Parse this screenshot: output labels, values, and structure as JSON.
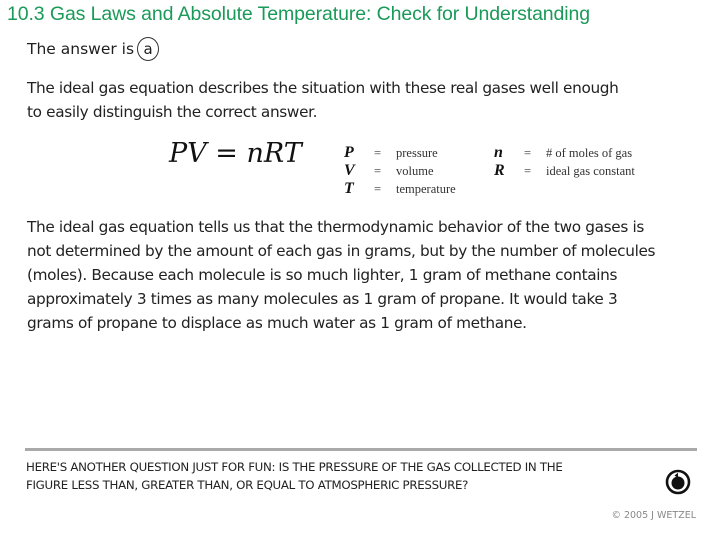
{
  "header": {
    "title": "10.3 Gas Laws and Absolute Temperature: Check for Understanding"
  },
  "answer": {
    "prefix": "The answer is",
    "choice": "a"
  },
  "explanation": {
    "paragraph1_lines": [
      "The ideal gas equation describes the situation with these real gases well enough",
      "to easily distinguish the correct answer."
    ],
    "equation": "PV = nRT",
    "variables_left": [
      {
        "symbol": "P",
        "equals": "=",
        "meaning": "pressure"
      },
      {
        "symbol": "V",
        "equals": "=",
        "meaning": "volume"
      },
      {
        "symbol": "T",
        "equals": "=",
        "meaning": "temperature"
      }
    ],
    "variables_right": [
      {
        "symbol": "n",
        "equals": "=",
        "meaning": "# of moles of gas"
      },
      {
        "symbol": "R",
        "equals": "=",
        "meaning": "ideal gas constant"
      }
    ],
    "paragraph2_lines": [
      "The ideal gas equation tells us that the thermodynamic behavior of the two gases is",
      "not determined by the amount of each gas in grams, but by the number of molecules",
      "(moles).  Because each molecule is so much lighter, 1 gram of methane contains",
      "approximately 3 times as many molecules as 1 gram of propane.  It would take 3",
      "grams of propane to displace as much water as 1 gram of methane."
    ]
  },
  "footer": {
    "question_lines": [
      "HERE'S ANOTHER QUESTION JUST FOR FUN:  IS THE PRESSURE OF THE GAS COLLECTED IN THE",
      "FIGURE LESS THAN, GREATER THAN, OR EQUAL TO ATMOSPHERIC PRESSURE?"
    ],
    "replay_icon": "replay-icon",
    "copyright": "© 2005 J WETZEL"
  },
  "colors": {
    "title": "#1a9a58",
    "divider": "#a9a9a9"
  }
}
